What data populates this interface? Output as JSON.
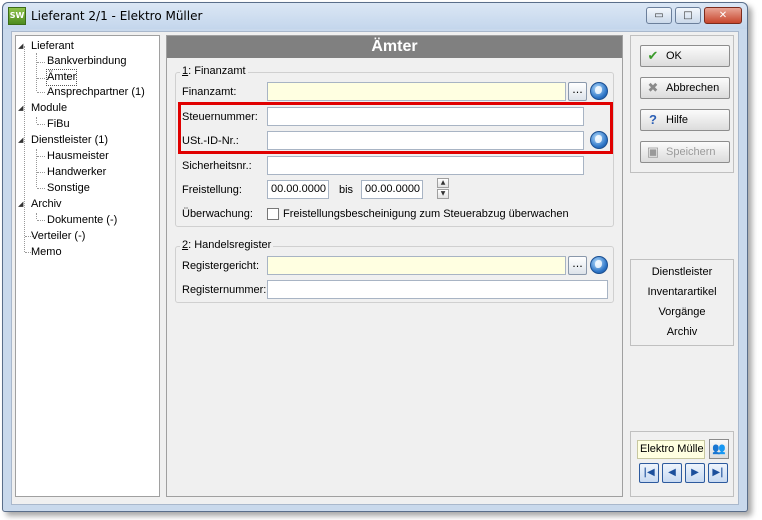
{
  "window": {
    "title": "Lieferant 2/1 - Elektro Müller",
    "app_icon": "SW",
    "minimize": "▭",
    "maximize": "□",
    "close": "✕"
  },
  "tree": {
    "items": [
      {
        "label": "Lieferant",
        "expanded": true
      },
      {
        "label": "Bankverbindung"
      },
      {
        "label": "Ämter",
        "selected": true
      },
      {
        "label": "Ansprechpartner (1)"
      },
      {
        "label": "Module",
        "expanded": true
      },
      {
        "label": "FiBu"
      },
      {
        "label": "Dienstleister (1)",
        "expanded": true
      },
      {
        "label": "Hausmeister"
      },
      {
        "label": "Handwerker"
      },
      {
        "label": "Sonstige"
      },
      {
        "label": "Archiv",
        "expanded": true
      },
      {
        "label": "Dokumente (-)"
      },
      {
        "label": "Verteiler (-)"
      },
      {
        "label": "Memo"
      }
    ]
  },
  "main": {
    "header": "Ämter",
    "finanzamt_group": {
      "label_prefix": "1",
      "label": ": Finanzamt",
      "finanzamt_label": "Finanzamt:",
      "finanzamt_value": "",
      "steuernummer_label": "Steuernummer:",
      "steuernummer_value": "",
      "ustid_label": "USt.-ID-Nr.:",
      "ustid_value": "",
      "sicherheitsnr_label": "Sicherheitsnr.:",
      "sicherheitsnr_value": "",
      "freistellung_label": "Freistellung:",
      "freistellung_from": "00.00.0000",
      "bis_label": "bis",
      "freistellung_to": "00.00.0000",
      "ueberwachung_label": "Überwachung:",
      "ueberwachung_checkbox_label": "Freistellungsbescheinigung zum Steuerabzug überwachen",
      "ueberwachung_checked": false
    },
    "handelsregister_group": {
      "label_prefix": "2",
      "label": ": Handelsregister",
      "registergericht_label": "Registergericht:",
      "registergericht_value": "",
      "registernummer_label": "Registernummer:",
      "registernummer_value": ""
    },
    "dots": "...",
    "highlight_color": "#e00000",
    "field_yellow": "#ffffe1"
  },
  "actions": {
    "ok": "OK",
    "abbrechen": "Abbrechen",
    "hilfe": "Hilfe",
    "speichern": "Speichern"
  },
  "links": [
    "Dienstleister",
    "Inventarartikel",
    "Vorgänge",
    "Archiv"
  ],
  "navigator": {
    "record_name": "Elektro Müller",
    "first": "|◀",
    "prev": "◀",
    "next": "▶",
    "last": "▶|"
  }
}
